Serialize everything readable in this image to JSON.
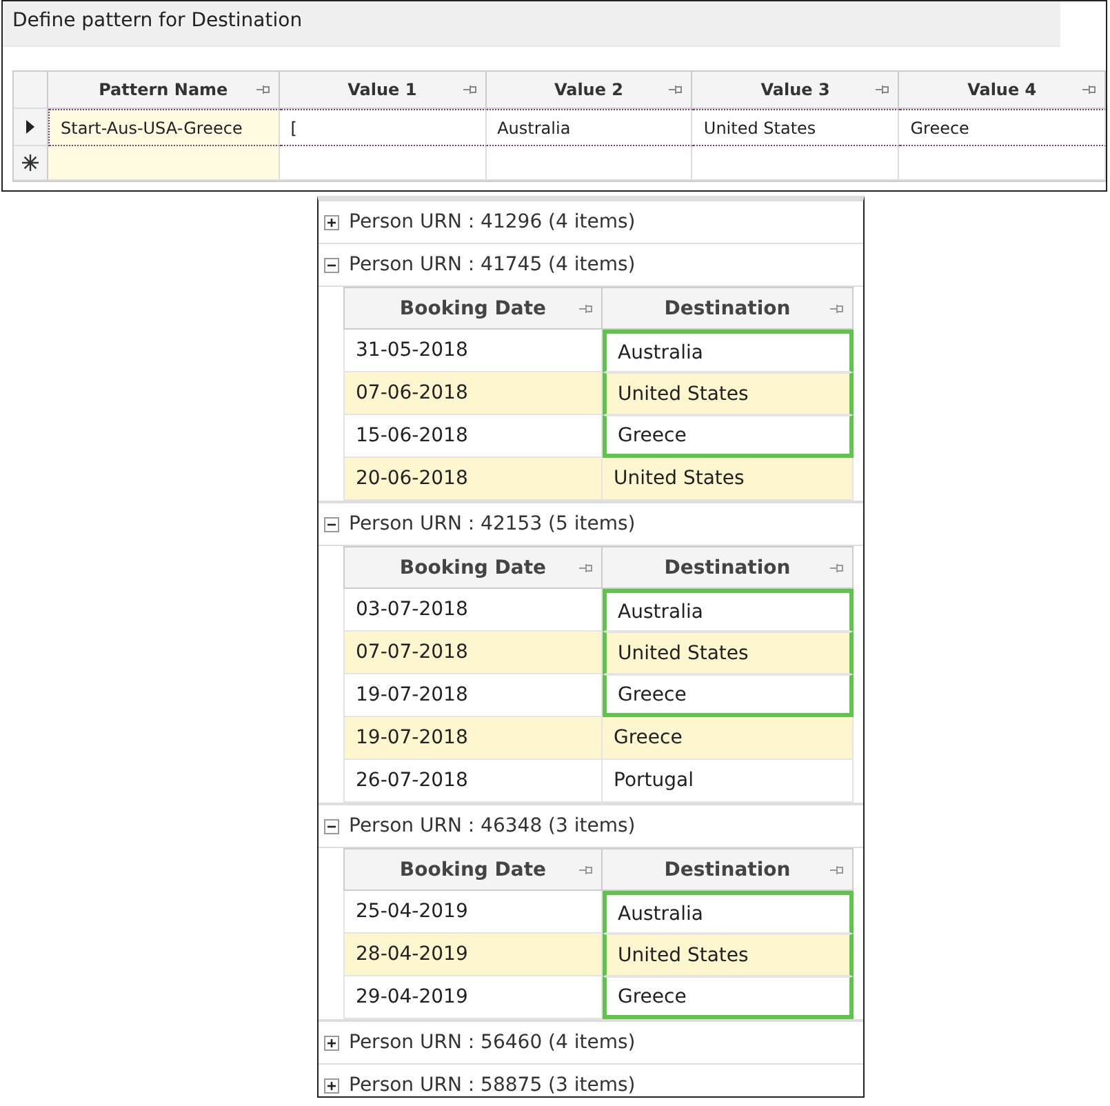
{
  "pattern_editor": {
    "title": "Define pattern for Destination",
    "columns": [
      "Pattern Name",
      "Value 1",
      "Value 2",
      "Value 3",
      "Value 4"
    ],
    "rows": [
      {
        "kind": "current",
        "cells": [
          "Start-Aus-USA-Greece",
          "[",
          "Australia",
          "United States",
          "Greece"
        ]
      },
      {
        "kind": "new",
        "cells": [
          "",
          "",
          "",
          "",
          ""
        ]
      }
    ]
  },
  "bookings": {
    "groups": [
      {
        "label": "Person URN : 41296 (4 items)",
        "expanded": false
      },
      {
        "label": "Person URN : 41745 (4 items)",
        "expanded": true,
        "columns": [
          "Booking Date",
          "Destination"
        ],
        "rows": [
          {
            "date": "31-05-2018",
            "destination": "Australia",
            "matched": true
          },
          {
            "date": "07-06-2018",
            "destination": "United States",
            "matched": true
          },
          {
            "date": "15-06-2018",
            "destination": "Greece",
            "matched": true
          },
          {
            "date": "20-06-2018",
            "destination": "United States",
            "matched": false
          }
        ]
      },
      {
        "label": "Person URN : 42153 (5 items)",
        "expanded": true,
        "columns": [
          "Booking Date",
          "Destination"
        ],
        "rows": [
          {
            "date": "03-07-2018",
            "destination": "Australia",
            "matched": true
          },
          {
            "date": "07-07-2018",
            "destination": "United States",
            "matched": true
          },
          {
            "date": "19-07-2018",
            "destination": "Greece",
            "matched": true
          },
          {
            "date": "19-07-2018",
            "destination": "Greece",
            "matched": false
          },
          {
            "date": "26-07-2018",
            "destination": "Portugal",
            "matched": false
          }
        ]
      },
      {
        "label": "Person URN : 46348 (3 items)",
        "expanded": true,
        "columns": [
          "Booking Date",
          "Destination"
        ],
        "rows": [
          {
            "date": "25-04-2019",
            "destination": "Australia",
            "matched": true
          },
          {
            "date": "28-04-2019",
            "destination": "United States",
            "matched": true
          },
          {
            "date": "29-04-2019",
            "destination": "Greece",
            "matched": true
          }
        ]
      },
      {
        "label": "Person URN : 56460 (4 items)",
        "expanded": false
      },
      {
        "label": "Person URN : 58875 (3 items)",
        "expanded": false
      }
    ]
  }
}
